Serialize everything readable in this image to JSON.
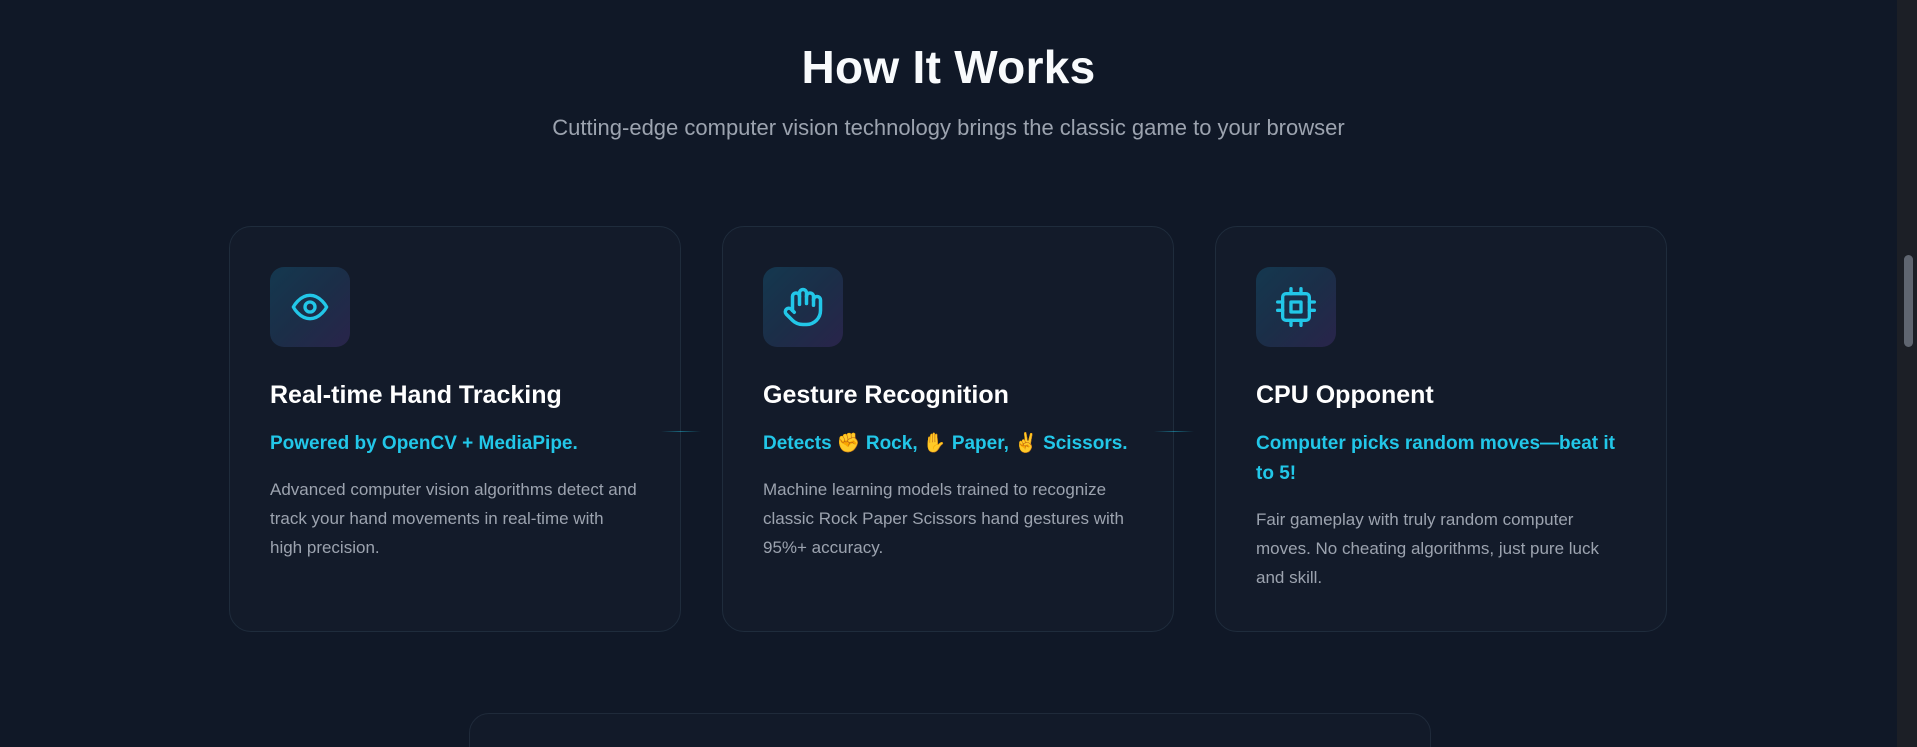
{
  "section": {
    "title": "How It Works",
    "subtitle": "Cutting-edge computer vision technology brings the classic game to your browser"
  },
  "cards": [
    {
      "icon": "eye-icon",
      "title": "Real-time Hand Tracking",
      "highlight": "Powered by OpenCV + MediaPipe.",
      "body": "Advanced computer vision algorithms detect and track your hand movements in real-time with high precision."
    },
    {
      "icon": "hand-icon",
      "title": "Gesture Recognition",
      "highlight": "Detects ✊ Rock, ✋ Paper, ✌️ Scissors.",
      "body": "Machine learning models trained to recognize classic Rock Paper Scissors hand gestures with 95%+ accuracy."
    },
    {
      "icon": "cpu-icon",
      "title": "CPU Opponent",
      "highlight": "Computer picks random moves—beat it to 5!",
      "body": "Fair gameplay with truly random computer moves. No cheating algorithms, just pure luck and skill."
    }
  ],
  "colors": {
    "background": "#101827",
    "accent": "#22c7e8",
    "card": "#131b2a",
    "muted_text": "#9ca3af"
  }
}
